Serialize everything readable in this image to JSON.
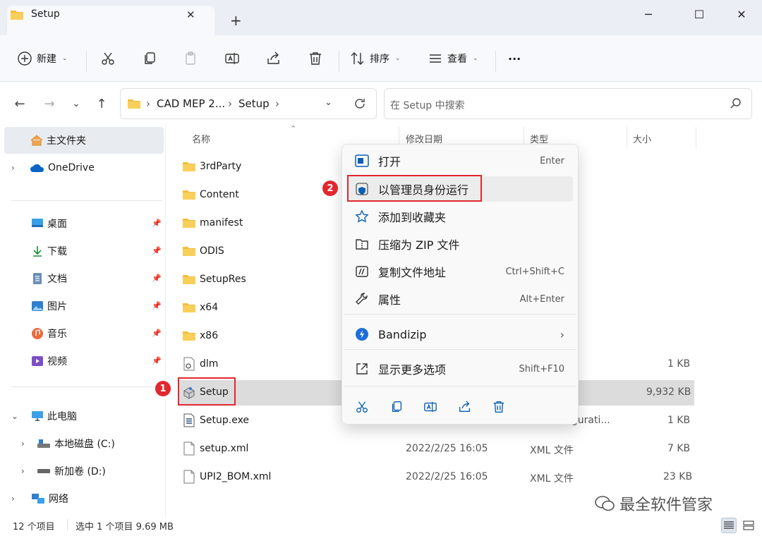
{
  "window": {
    "tab_title": "Setup",
    "new_tab": "+",
    "tab_close": "✕",
    "minimize": "─",
    "maximize": "☐",
    "close": "✕"
  },
  "toolbar": {
    "new_label": "新建",
    "sort_label": "排序",
    "view_label": "查看",
    "more_label": "···"
  },
  "address": {
    "crumb1": "CAD MEP 2...",
    "crumb2": "Setup",
    "search_placeholder": "在 Setup 中搜索"
  },
  "sidebar": {
    "home": "主文件夹",
    "onedrive": "OneDrive",
    "quick": [
      {
        "label": "桌面",
        "icon": "desktop-icon"
      },
      {
        "label": "下载",
        "icon": "download-icon"
      },
      {
        "label": "文档",
        "icon": "documents-icon"
      },
      {
        "label": "图片",
        "icon": "pictures-icon"
      },
      {
        "label": "音乐",
        "icon": "music-icon"
      },
      {
        "label": "视频",
        "icon": "videos-icon"
      }
    ],
    "this_pc": "此电脑",
    "drive_c": "本地磁盘 (C:)",
    "drive_d": "新加卷 (D:)",
    "network": "网络"
  },
  "columns": {
    "name": "名称",
    "modified": "修改日期",
    "type": "类型",
    "size": "大小"
  },
  "files": [
    {
      "name": "3rdParty",
      "icon": "folder-icon",
      "date": "",
      "type": "",
      "size": ""
    },
    {
      "name": "Content",
      "icon": "folder-icon",
      "date": "",
      "type": "",
      "size": ""
    },
    {
      "name": "manifest",
      "icon": "folder-icon",
      "date": "",
      "type": "",
      "size": ""
    },
    {
      "name": "ODIS",
      "icon": "folder-icon",
      "date": "",
      "type": "",
      "size": ""
    },
    {
      "name": "SetupRes",
      "icon": "folder-icon",
      "date": "",
      "type": "",
      "size": ""
    },
    {
      "name": "x64",
      "icon": "folder-icon",
      "date": "",
      "type": "",
      "size": ""
    },
    {
      "name": "x86",
      "icon": "folder-icon",
      "date": "",
      "type": "",
      "size": ""
    },
    {
      "name": "dlm",
      "icon": "settings-file-icon",
      "date": "",
      "type": "",
      "size": "1 KB"
    },
    {
      "name": "Setup",
      "icon": "setup-app-icon",
      "date": "",
      "type": "",
      "size": "9,932 KB"
    },
    {
      "name": "Setup.exe",
      "icon": "config-file-icon",
      "date": "",
      "type": "igurati...",
      "size": "1 KB"
    },
    {
      "name": "setup.xml",
      "icon": "file-icon",
      "date": "2022/2/25 16:05",
      "type": "XML 文件",
      "size": "7 KB"
    },
    {
      "name": "UPI2_BOM.xml",
      "icon": "file-icon",
      "date": "2022/2/25 16:05",
      "type": "XML 文件",
      "size": "23 KB"
    }
  ],
  "context_menu": {
    "items": [
      {
        "label": "打开",
        "shortcut": "Enter",
        "icon": "open-icon"
      },
      {
        "label": "以管理员身份运行",
        "shortcut": "",
        "icon": "shield-icon"
      },
      {
        "label": "添加到收藏夹",
        "shortcut": "",
        "icon": "star-icon"
      },
      {
        "label": "压缩为 ZIP 文件",
        "shortcut": "",
        "icon": "zip-icon"
      },
      {
        "label": "复制文件地址",
        "shortcut": "Ctrl+Shift+C",
        "icon": "copy-path-icon"
      },
      {
        "label": "属性",
        "shortcut": "Alt+Enter",
        "icon": "wrench-icon"
      },
      {
        "label": "Bandizip",
        "shortcut": "",
        "icon": "bandizip-icon"
      },
      {
        "label": "显示更多选项",
        "shortcut": "Shift+F10",
        "icon": "more-options-icon"
      }
    ],
    "submenu_arrow": "›"
  },
  "annotations": {
    "badge1": "1",
    "badge2": "2"
  },
  "status": {
    "count": "12 个项目",
    "selected": "选中 1 个项目  9.69 MB"
  },
  "watermark": "最全软件管家",
  "colors": {
    "accent": "#0067c0",
    "folder": "#f3bd3c",
    "highlight_red": "#e0282e",
    "selected_row": "#dcdcdc"
  }
}
